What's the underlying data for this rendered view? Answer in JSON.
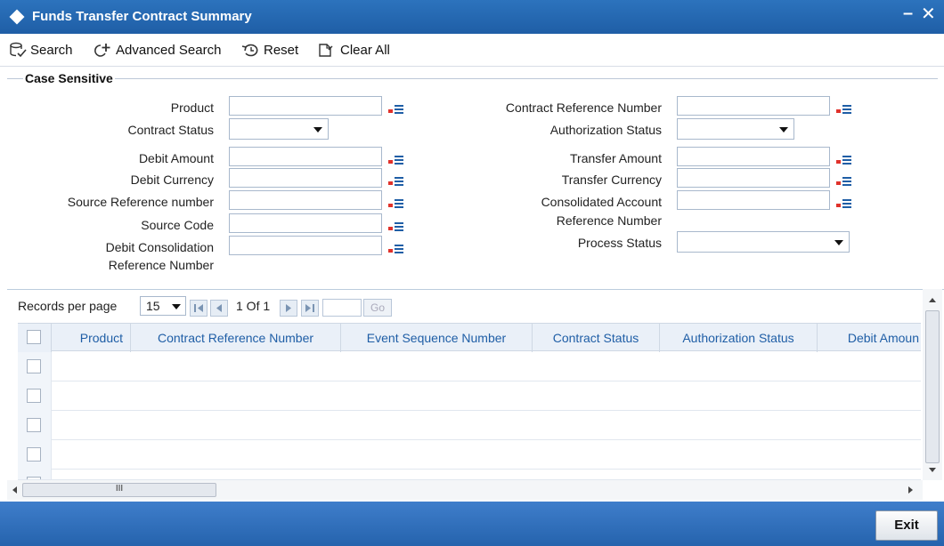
{
  "window": {
    "title": "Funds Transfer Contract Summary",
    "minimize": "–",
    "close": "✕"
  },
  "toolbar": {
    "search": "Search",
    "advanced_search": "Advanced Search",
    "reset": "Reset",
    "clear_all": "Clear All"
  },
  "criteria": {
    "legend": "Case Sensitive",
    "product": "Product",
    "contract_status": "Contract Status",
    "debit_amount": "Debit Amount",
    "debit_currency": "Debit Currency",
    "source_reference_number": "Source Reference number",
    "source_code": "Source Code",
    "debit_consolidation_line1": "Debit Consolidation",
    "debit_consolidation_line2": "Reference Number",
    "contract_reference_number": "Contract Reference Number",
    "authorization_status": "Authorization Status",
    "transfer_amount": "Transfer Amount",
    "transfer_currency": "Transfer Currency",
    "consolidated_account_line1": "Consolidated Account",
    "consolidated_account_line2": "Reference Number",
    "process_status": "Process Status"
  },
  "pager": {
    "records_per_page_label": "Records per page",
    "records_per_page_value": "15",
    "page_text": "1 Of 1",
    "go": "Go"
  },
  "grid": {
    "columns": [
      "Product",
      "Contract Reference Number",
      "Event Sequence Number",
      "Contract Status",
      "Authorization Status",
      "Debit Amoun"
    ]
  },
  "scrollbar": {
    "grip": "III"
  },
  "footer": {
    "exit": "Exit"
  },
  "colors": {
    "titlebar": "#1f5ea6",
    "header_text": "#1f5ea6",
    "footer": "#2563ad"
  }
}
